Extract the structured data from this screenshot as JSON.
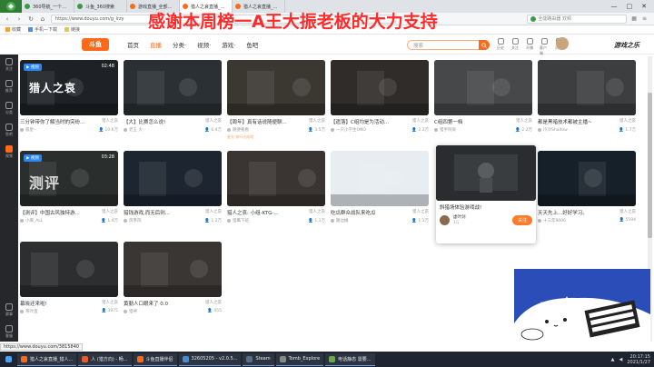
{
  "browser": {
    "tabs": [
      {
        "label": "360导航_一个主页，整个世界",
        "color": "#3a9b46",
        "active": false
      },
      {
        "label": "斗鱼_360搜索",
        "color": "#3a9b46",
        "active": false
      },
      {
        "label": "游戏直播_全部游戏直播...",
        "color": "#ff6a1a",
        "active": false
      },
      {
        "label": "猎人之哀直播_猎人之哀直播...",
        "color": "#ff6a1a",
        "active": true
      },
      {
        "label": "猎人之哀直播_猎人之...",
        "color": "#ff6a1a",
        "active": false
      }
    ],
    "url": "https://www.douyu.com/g_lrzy",
    "search_placeholder": "全能路由器 双频",
    "bookmarks": [
      "收藏",
      "手机—下载",
      "链接"
    ]
  },
  "overlay_banner": "感谢本周榜一A王大振老板的大力支持",
  "site": {
    "logo": "斗鱼",
    "nav": [
      "首页",
      "直播",
      "分类·",
      "视频·",
      "游戏·",
      "鱼吧"
    ],
    "search_placeholder": "搜索",
    "icons": [
      "历史",
      "关注",
      "开播",
      "客户端",
      "消息"
    ],
    "brand": "游戏之乐"
  },
  "sidebar": [
    {
      "label": "关注",
      "icon": "heart-icon"
    },
    {
      "label": "推荐",
      "icon": "thumb-icon"
    },
    {
      "label": "分类",
      "icon": "grid-icon"
    },
    {
      "label": "鱼吧",
      "icon": "fish-icon"
    },
    {
      "label": "视频",
      "icon": "video-icon",
      "active": true
    },
    {
      "label": "赛事",
      "icon": "trophy-icon"
    },
    {
      "label": "客服",
      "icon": "headset-icon"
    }
  ],
  "cards": [
    {
      "title": "三分钟带你了解当时的突纷...",
      "category": "猎人之哀",
      "author": "孤星··",
      "count": "10.6万",
      "tag": "",
      "badge": "视频",
      "duration": "02:48",
      "bigtext": "猎人之哀",
      "bg": "#1e2226"
    },
    {
      "title": "【大】比赛怎么说!",
      "category": "猎人之哀",
      "author": "老王 大",
      "count": "6.4万",
      "tag": "",
      "badge": "",
      "duration": "",
      "bigtext": "",
      "bg": "#2a3034"
    },
    {
      "title": "【周年】真有话说随便聊...",
      "category": "猎人之哀",
      "author": "随便看看",
      "count": "3.5万",
      "tag": "星光·排行达成就",
      "badge": "",
      "duration": "",
      "bigtext": "",
      "bg": "#3b3731"
    },
    {
      "title": "【遗落】C组均是为活动...",
      "category": "猎人之哀",
      "author": "一只小学生ONO",
      "count": "2.2万",
      "tag": "",
      "badge": "",
      "duration": "",
      "bigtext": "",
      "bg": "#2f2c2a"
    },
    {
      "title": "C组四第一档",
      "category": "猎人之哀",
      "author": "猎手阿柒",
      "count": "2.2万",
      "tag": "",
      "badge": "",
      "duration": "",
      "bigtext": "",
      "bg": "#46484a"
    },
    {
      "title": "都是黑暗技术都被主播~",
      "category": "猎人之哀",
      "author": "冷冷Shadow",
      "count": "1.7万",
      "tag": "",
      "badge": "",
      "duration": "",
      "bigtext": "",
      "bg": "#3c3e40"
    },
    {
      "title": "【测评】中国古风独特游...",
      "category": "猎人之哀",
      "author": "小麻_ALL",
      "count": "1.4万",
      "tag": "",
      "badge": "视频",
      "duration": "03:28",
      "bigtext": "测评",
      "bg": "#2a2e2c"
    },
    {
      "title": "猎钱游戏,而无后则...",
      "category": "猎人之哀",
      "author": "风筝风",
      "count": "1.2万",
      "tag": "",
      "badge": "",
      "duration": "",
      "bigtext": "",
      "bg": "#1d2530"
    },
    {
      "title": "猎人之哀: 小组-KTG-...",
      "category": "猎人之哀",
      "author": "猎鹰下班",
      "count": "1.1万",
      "tag": "",
      "badge": "",
      "duration": "",
      "bigtext": "",
      "bg": "#3a3532"
    },
    {
      "title": "吃瓜群众战队来吃瓜",
      "category": "猎人之哀",
      "author": "路边摊",
      "count": "1.1万",
      "tag": "",
      "badge": "",
      "duration": "",
      "bigtext": "",
      "bg": "#e8edf2"
    },
    {
      "title": "猎人之哀今年主播了吗?",
      "category": "猎人之哀",
      "author": "猎人之哀...",
      "count": "9935",
      "tag": "",
      "badge": "",
      "duration": "",
      "bigtext": "",
      "bg": "#24272b"
    },
    {
      "title": "天天先上...好好学习。",
      "category": "猎人之哀",
      "author": "十三年9006",
      "count": "5594",
      "tag": "",
      "badge": "",
      "duration": "",
      "bigtext": "",
      "bg": "#162029"
    },
    {
      "title": "幕晓还来啦!",
      "category": "猎人之哀",
      "author": "茶叶蛋",
      "count": "3975",
      "tag": "",
      "badge": "",
      "duration": "",
      "bigtext": "",
      "bg": "#2c2e30"
    },
    {
      "title": "黄勤人口眼来了 0.0",
      "category": "猎人之哀",
      "author": "猎神",
      "count": "455",
      "tag": "",
      "badge": "",
      "duration": "",
      "bigtext": "",
      "bg": "#3a3634"
    }
  ],
  "popup": {
    "title": "斜猎场体验游戏战!",
    "author": "虚叶剑",
    "fans": "1万",
    "follow": "关注",
    "bg": "#2a2c2f"
  },
  "status_url": "https://www.douyu.com/3815840",
  "mascot": {
    "text": "游戏之乐"
  },
  "taskbar": {
    "items": [
      {
        "label": "猎人之哀直播_猎人...",
        "color": "#ff6a1a"
      },
      {
        "label": "人 (猎方向) - 畅...",
        "color": "#e55b2b"
      },
      {
        "label": "斗鱼直播伴侣",
        "color": "#ff6a1a"
      },
      {
        "label": "32605205 - v2.0.5...",
        "color": "#4a8bd6"
      },
      {
        "label": "Steam",
        "color": "#1b2838"
      },
      {
        "label": "Tomb_Explore",
        "color": "#888888"
      },
      {
        "label": "电话静态 需要...",
        "color": "#6aa84f"
      }
    ],
    "time": "20:17:15",
    "date": "2021/1/27"
  }
}
